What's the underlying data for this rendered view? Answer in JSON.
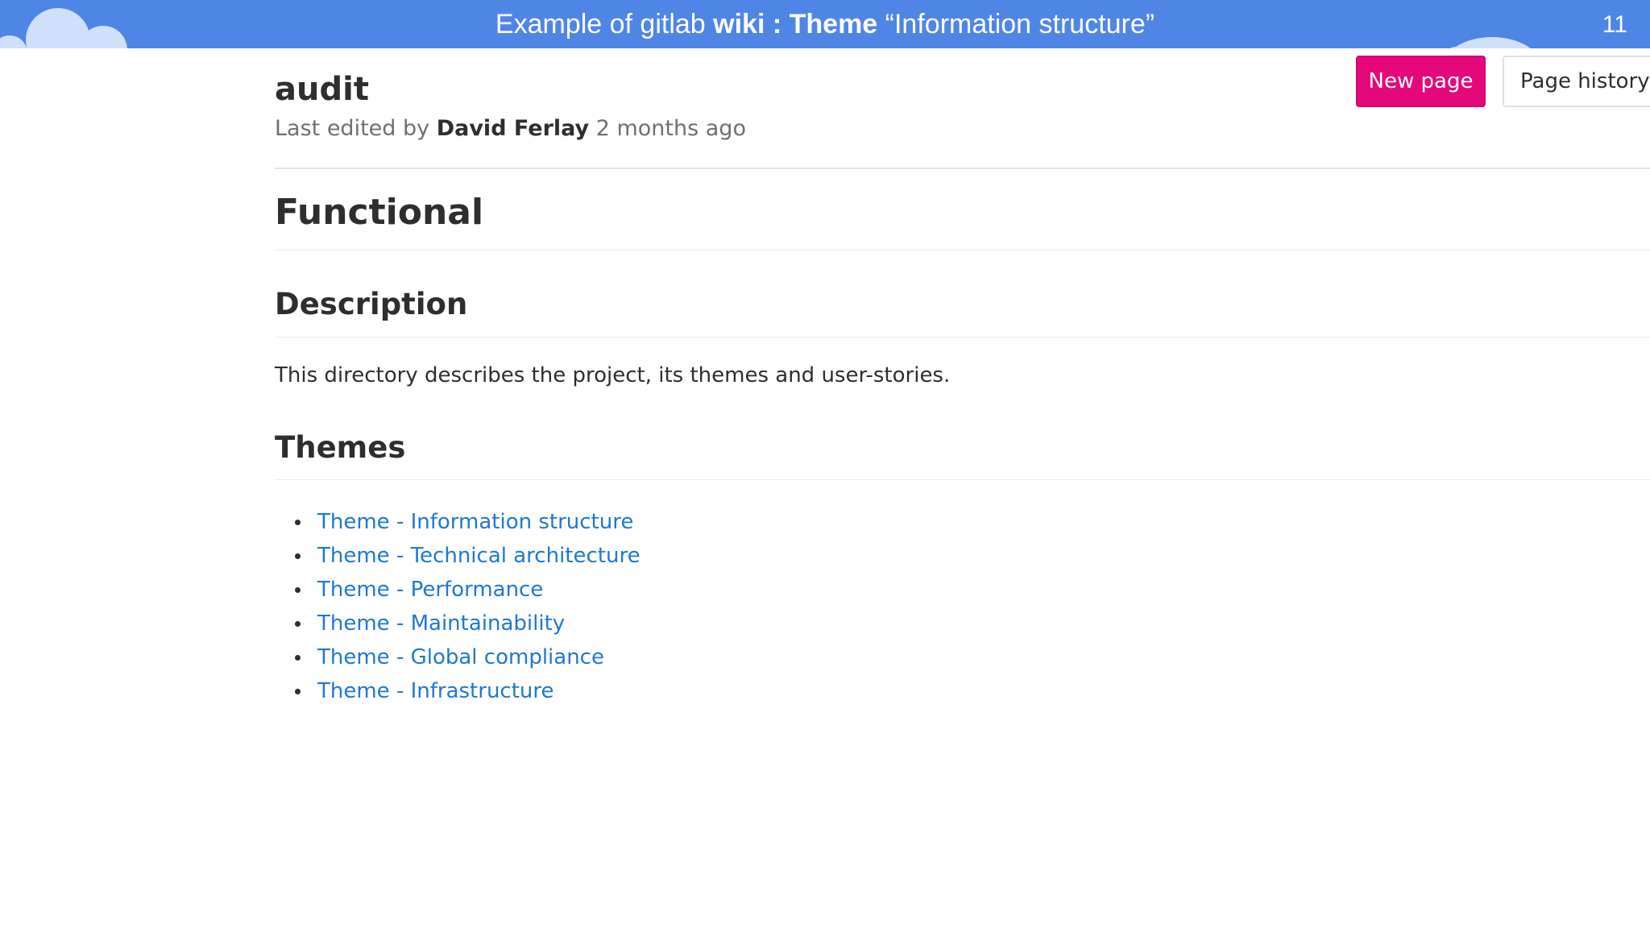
{
  "slide": {
    "title_prefix": "Example of gitlab ",
    "title_bold": "wiki : Theme",
    "title_suffix": " “Information structure”",
    "page_number": "11",
    "header_color": "#4f86e6"
  },
  "wiki": {
    "page_title": "audit",
    "meta": {
      "prefix": "Last edited by ",
      "author": "David Ferlay",
      "suffix": " 2 months ago"
    },
    "buttons": {
      "new_page": "New page",
      "page_history": "Page history"
    },
    "content": {
      "h1": "Functional",
      "description_heading": "Description",
      "description_text": "This directory describes the project, its themes and user-stories.",
      "themes_heading": "Themes",
      "themes": [
        "Theme - Information structure",
        "Theme - Technical architecture",
        "Theme - Performance",
        "Theme - Maintainability",
        "Theme - Global compliance",
        "Theme - Infrastructure"
      ]
    },
    "colors": {
      "new_page_button": "#e5087a",
      "link": "#1f78d1"
    }
  }
}
